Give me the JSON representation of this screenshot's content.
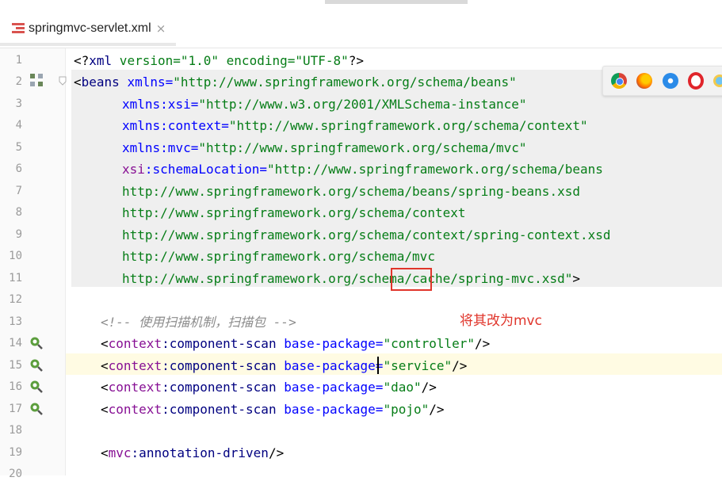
{
  "tab": {
    "title": "springmvc-servlet.xml",
    "close": "×",
    "icon": "spring-xml-file-icon"
  },
  "lines": [
    {
      "n": "1"
    },
    {
      "n": "2"
    },
    {
      "n": "3"
    },
    {
      "n": "4"
    },
    {
      "n": "5"
    },
    {
      "n": "6"
    },
    {
      "n": "7"
    },
    {
      "n": "8"
    },
    {
      "n": "9"
    },
    {
      "n": "10"
    },
    {
      "n": "11"
    },
    {
      "n": "12"
    },
    {
      "n": "13"
    },
    {
      "n": "14"
    },
    {
      "n": "15"
    },
    {
      "n": "16"
    },
    {
      "n": "17"
    },
    {
      "n": "18"
    },
    {
      "n": "19"
    },
    {
      "n": "20"
    }
  ],
  "code": {
    "l1_pi_open": "<?",
    "l1_xml": "xml",
    "l1_rest": " version=\"1.0\" encoding=\"UTF-8\"",
    "l1_pi_close": "?>",
    "l2_open": "<",
    "l2_tag": "beans",
    "l2_attr": " xmlns=",
    "l2_val": "\"http://www.springframework.org/schema/beans\"",
    "l3_ns": "xmlns",
    "l3_local": ":xsi=",
    "l3_val": "\"http://www.w3.org/2001/XMLSchema-instance\"",
    "l4_ns": "xmlns",
    "l4_local": ":context=",
    "l4_val": "\"http://www.springframework.org/schema/context\"",
    "l5_ns": "xmlns",
    "l5_local": ":mvc=",
    "l5_val": "\"http://www.springframework.org/schema/mvc\"",
    "l6_ns": "xsi",
    "l6_local": ":schemaLocation=",
    "l6_val": "\"http://www.springframework.org/schema/beans",
    "l7": "http://www.springframework.org/schema/beans/spring-beans.xsd",
    "l8": "http://www.springframework.org/schema/context",
    "l9": "http://www.springframework.org/schema/context/spring-context.xsd",
    "l10": "http://www.springframework.org/schema/mvc",
    "l11_val": "http://www.springframework.org/schema/cache/spring-mvc.xsd\"",
    "l11_close": ">",
    "l13_comment": "<!-- 使用扫描机制，扫描包 -->",
    "scan_ns": "context",
    "scan_local": ":component-scan",
    "scan_attr": " base-package=",
    "scan_lines": [
      "\"controller\"",
      "\"service\"",
      "\"dao\"",
      "\"pojo\""
    ],
    "selfclose": "/>",
    "l19_ns": "mvc",
    "l19_local": ":annotation-driven"
  },
  "annotation": {
    "note": "将其改为mvc"
  },
  "browsers": [
    "chrome-icon",
    "firefox-icon",
    "safari-icon",
    "opera-icon",
    "ie-icon"
  ],
  "colors": {
    "annotation_red": "#e0352b"
  }
}
